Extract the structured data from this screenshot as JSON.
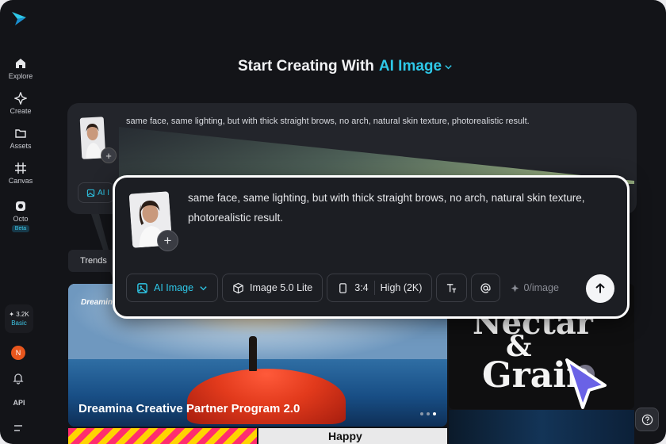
{
  "sidebar": {
    "logo_icon": "dreamina-logo",
    "items": [
      {
        "label": "Explore",
        "icon": "home-icon"
      },
      {
        "label": "Create",
        "icon": "sparkle-icon"
      },
      {
        "label": "Assets",
        "icon": "folder-icon"
      },
      {
        "label": "Canvas",
        "icon": "canvas-icon"
      },
      {
        "label": "Octo",
        "icon": "octo-icon",
        "badge": "Beta"
      }
    ],
    "credits": {
      "amount": "✦ 3.2K",
      "plan": "Basic"
    },
    "avatar_initial": "N",
    "api_label": "API"
  },
  "heading": {
    "prefix": "Start Creating With",
    "mode": "AI Image"
  },
  "background_prompt": {
    "text": "same face, same lighting, but with thick straight brows, no arch, natural skin texture, photorealistic result.",
    "mode_chip": "AI I"
  },
  "prompt_panel": {
    "text": "same face, same lighting, but with thick straight brows, no arch, natural skin texture, photorealistic result.",
    "toolbar": {
      "mode": "AI Image",
      "model": "Image 5.0 Lite",
      "ratio": "3:4",
      "quality": "High (2K)",
      "cost": "0/image"
    }
  },
  "trends_label": "Trends",
  "gallery": {
    "main_card": {
      "brand": "Dreamina",
      "title": "Dreamina Creative Partner Program 2.0"
    },
    "right_card": {
      "line1": "Nectar",
      "line2": "&",
      "line3": "Grain"
    },
    "bottom_card_text": "Happy"
  },
  "colors": {
    "accent": "#2ec8e8",
    "background": "#131418",
    "panel": "#1c1e23",
    "avatar": "#e8561d"
  }
}
